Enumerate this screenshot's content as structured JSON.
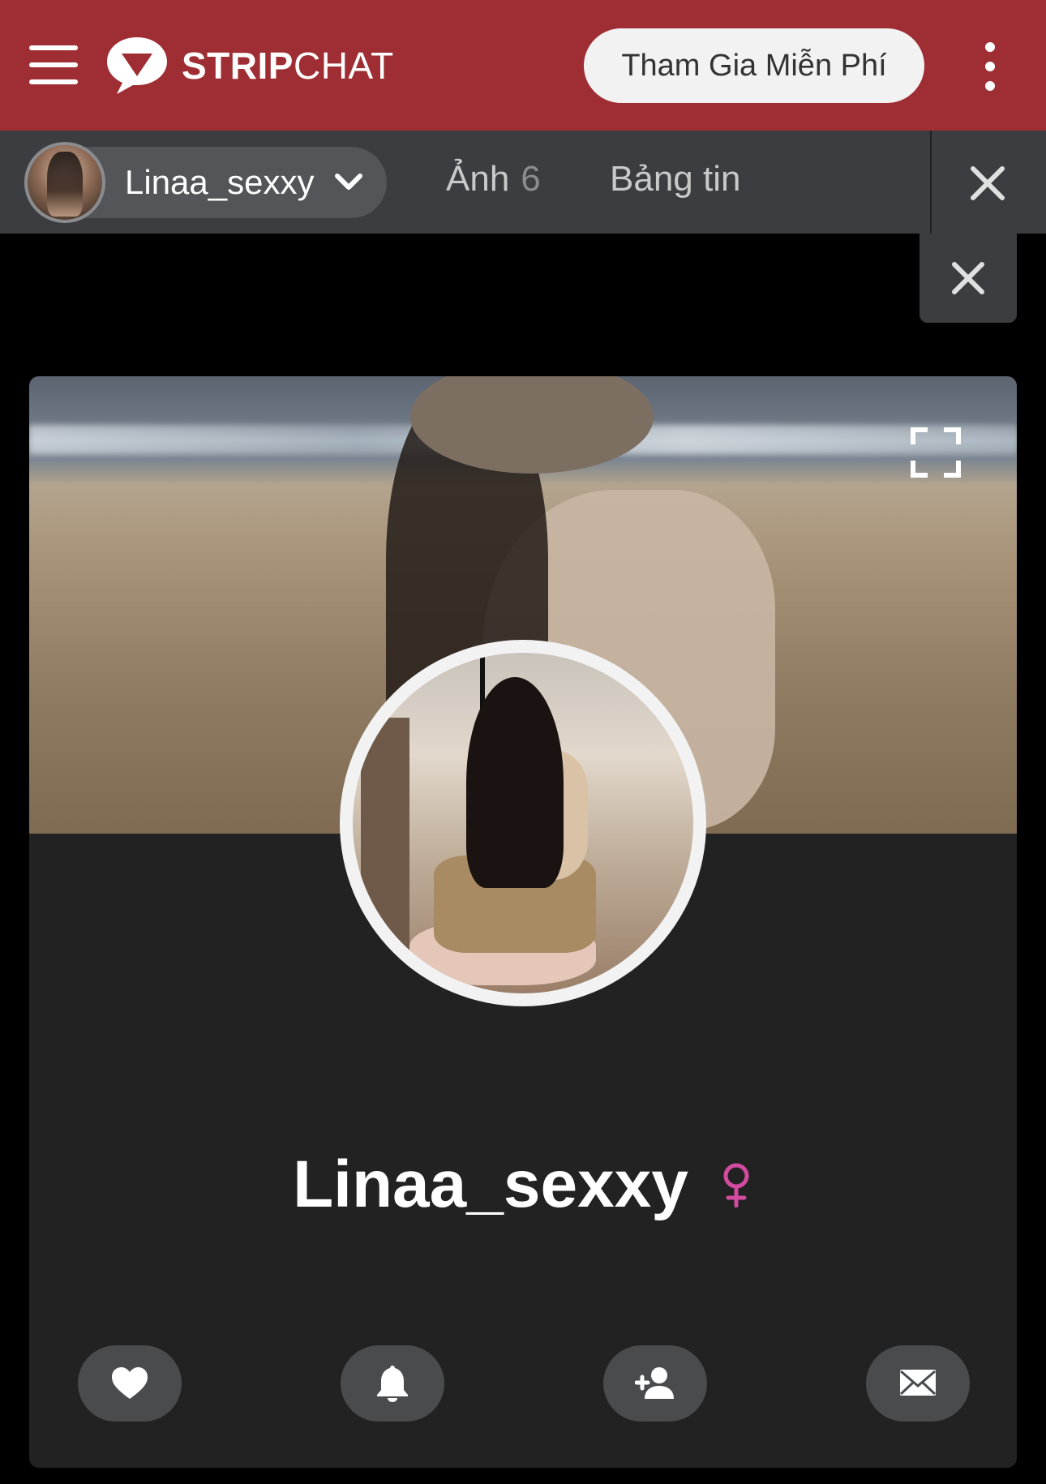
{
  "header": {
    "brand": {
      "part1": "STRIP",
      "part2": "CHAT"
    },
    "join_label": "Tham Gia Miễn Phí",
    "menu_icon": "hamburger-icon",
    "more_icon": "kebab-icon",
    "brand_color": "#9e2e33"
  },
  "subnav": {
    "model_name": "Linaa_sexxy",
    "tabs": [
      {
        "label": "Ảnh",
        "count": "6"
      },
      {
        "label": "Bảng tin"
      }
    ],
    "close_icon": "close-icon"
  },
  "profile": {
    "username": "Linaa_sexxy",
    "gender_icon": "venus-icon",
    "gender_color": "#d34ba0",
    "actions": [
      {
        "icon": "heart-icon"
      },
      {
        "icon": "bell-icon"
      },
      {
        "icon": "add-user-icon"
      },
      {
        "icon": "envelope-icon"
      }
    ]
  }
}
